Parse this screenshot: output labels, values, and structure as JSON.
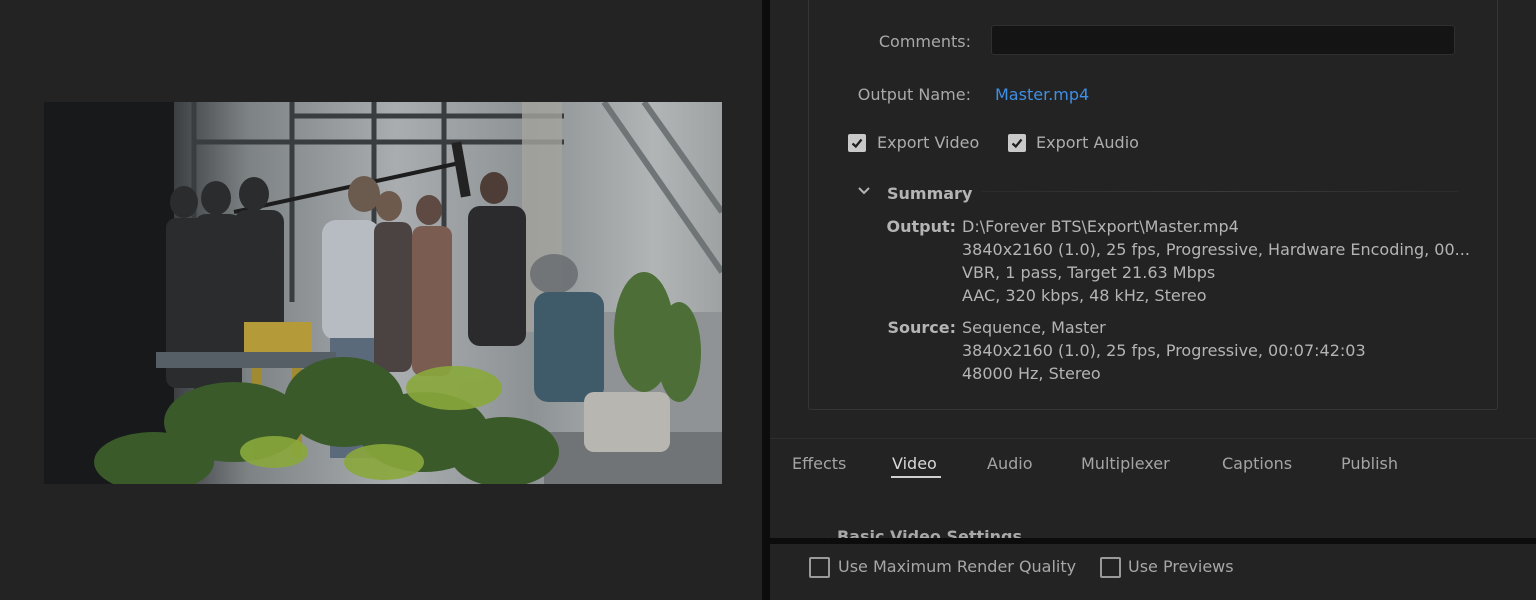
{
  "settings": {
    "comments_label": "Comments:",
    "comments_value": "",
    "output_name_label": "Output Name:",
    "output_name_value": "Master.mp4",
    "export_video": {
      "label": "Export Video",
      "checked": true
    },
    "export_audio": {
      "label": "Export Audio",
      "checked": true
    }
  },
  "summary": {
    "title": "Summary",
    "output_key": "Output:",
    "output_lines": [
      "D:\\Forever BTS\\Export\\Master.mp4",
      "3840x2160 (1.0), 25 fps, Progressive, Hardware Encoding, 00...",
      "VBR, 1 pass, Target 21.63 Mbps",
      "AAC, 320 kbps, 48 kHz, Stereo"
    ],
    "source_key": "Source:",
    "source_lines": [
      "Sequence, Master",
      "3840x2160 (1.0), 25 fps, Progressive, 00:07:42:03",
      "48000 Hz, Stereo"
    ]
  },
  "tabs": [
    {
      "label": "Effects",
      "active": false
    },
    {
      "label": "Video",
      "active": true
    },
    {
      "label": "Audio",
      "active": false
    },
    {
      "label": "Multiplexer",
      "active": false
    },
    {
      "label": "Captions",
      "active": false
    },
    {
      "label": "Publish",
      "active": false
    }
  ],
  "partial_section_label": "Basic Video Settings",
  "bottom": {
    "max_render_quality": {
      "label": "Use Maximum Render Quality",
      "checked": false
    },
    "use_previews": {
      "label": "Use Previews",
      "checked": false
    }
  },
  "icons": {
    "checkmark": "checkmark-icon",
    "summary_chevron": "chevron-down-icon"
  },
  "colors": {
    "panel_bg": "#232323",
    "link": "#3f8fe5",
    "checkbox_fill": "#c9c9c9"
  }
}
